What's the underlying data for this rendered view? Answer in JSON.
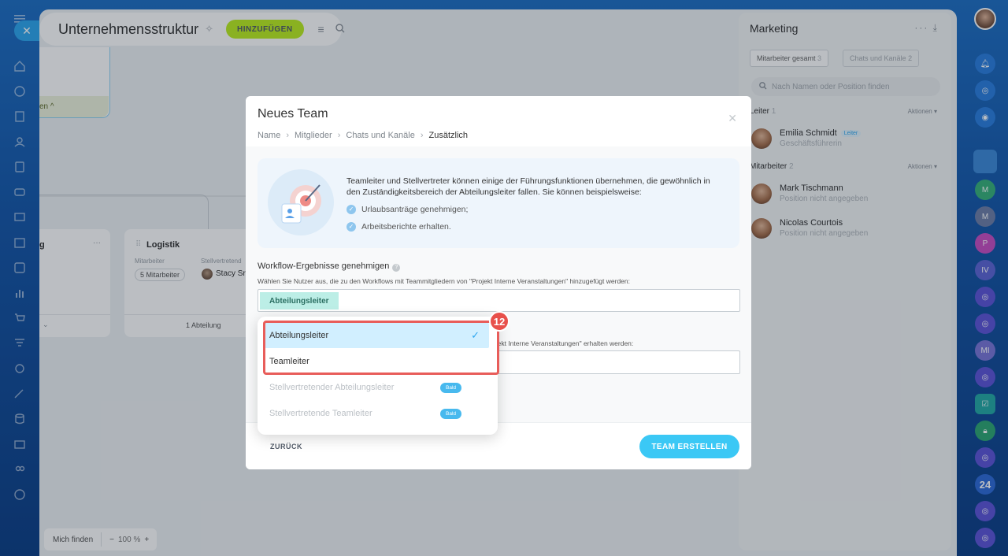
{
  "window": {
    "close_icon": "close-icon"
  },
  "topbar": {
    "title": "Unternehmensstruktur",
    "add_label": "HINZUFÜGEN"
  },
  "canvas": {
    "top_card_footer": "en ^",
    "dept_logistik": {
      "name": "Logistik",
      "employees_label": "Mitarbeiter",
      "deputy_label": "Stellvertretend",
      "employees_chip": "5 Mitarbeiter",
      "deputy_name": "Stacy Sr",
      "footer": "1 Abteilung"
    },
    "dept_left": {
      "name": "g"
    }
  },
  "zoom": {
    "find_label": "Mich finden",
    "minus": "−",
    "level": "100 %",
    "plus": "+"
  },
  "right_panel": {
    "title": "Marketing",
    "tabs": [
      {
        "label": "Mitarbeiter gesamt",
        "count": "3"
      },
      {
        "label": "Chats und Kanäle",
        "count": "2"
      }
    ],
    "search_placeholder": "Nach Namen oder Position finden",
    "leader_section": {
      "title": "Leiter",
      "count": "1",
      "action": "Aktionen"
    },
    "leader": {
      "name": "Emilia Schmidt",
      "badge": "Leiter",
      "position": "Geschäftsführerin"
    },
    "staff_section": {
      "title": "Mitarbeiter",
      "count": "2",
      "action": "Aktionen"
    },
    "staff": [
      {
        "name": "Mark Tischmann",
        "position": "Position nicht angegeben"
      },
      {
        "name": "Nicolas Courtois",
        "position": "Position nicht angegeben"
      }
    ]
  },
  "right_bar": {
    "badge_24": "24"
  },
  "modal": {
    "title": "Neues Team",
    "breadcrumbs": [
      "Name",
      "Mitglieder",
      "Chats und Kanäle",
      "Zusätzlich"
    ],
    "info_text": "Teamleiter und Stellvertreter können einige der Führungsfunktionen übernehmen, die gewöhnlich in den Zuständigkeitsbereich der Abteilungsleiter fallen. Sie können beispielsweise:",
    "info_items": [
      "Urlaubsanträge genehmigen;",
      "Arbeitsberichte erhalten."
    ],
    "workflow_label": "Workflow-Ergebnisse genehmigen",
    "workflow_desc": "Wählen Sie Nutzer aus, die zu den Workflows mit Teammitgliedern von \"Projekt Interne Veranstaltungen\" hinzugefügt werden:",
    "workflow_tag": "Abteilungsleiter",
    "reports_desc_partial": "ojekt Interne Veranstaltungen\" erhalten werden:",
    "back_label": "ZURÜCK",
    "create_label": "TEAM ERSTELLEN"
  },
  "dropdown": {
    "items": [
      {
        "label": "Abteilungsleiter",
        "selected": true
      },
      {
        "label": "Teamleiter",
        "selected": false
      },
      {
        "label": "Stellvertretender Abteilungsleiter",
        "disabled": true,
        "badge": "Bald"
      },
      {
        "label": "Stellvertretende Teamleiter",
        "disabled": true,
        "badge": "Bald"
      }
    ]
  },
  "annotation": {
    "step": "12",
    "color": "#e85d5a"
  }
}
